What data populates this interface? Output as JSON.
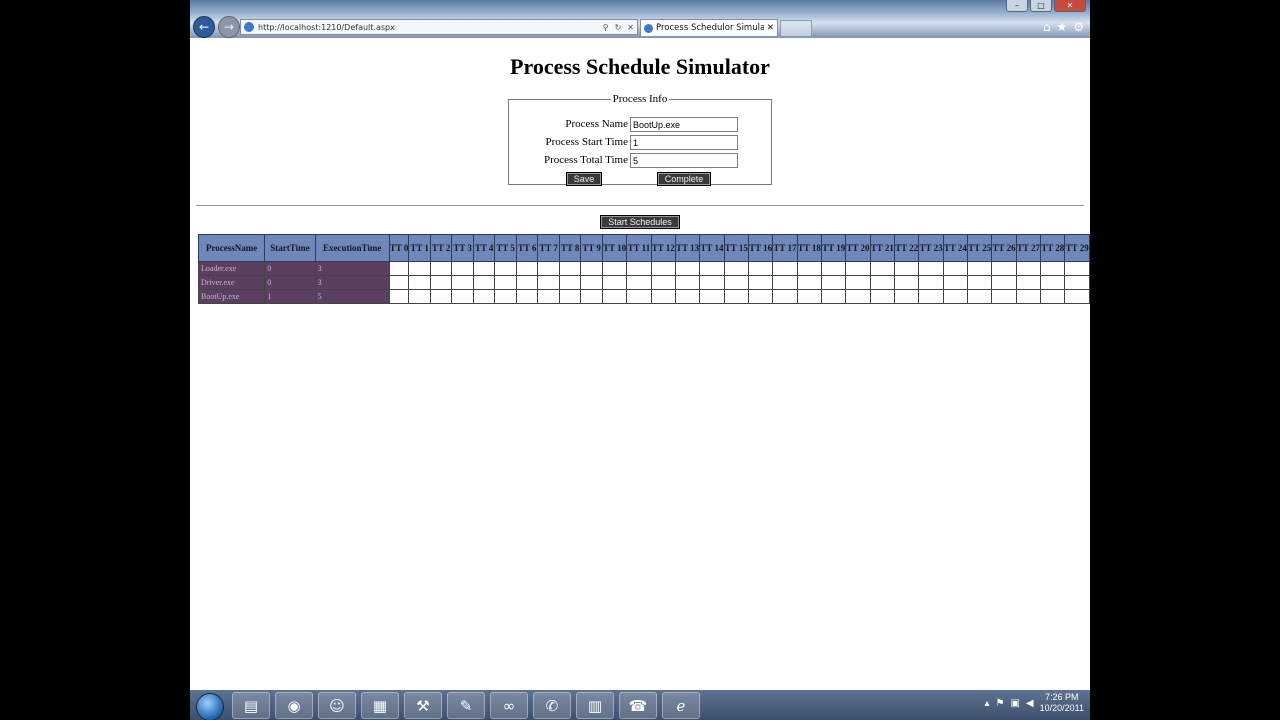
{
  "browser": {
    "address": "http://localhost:1210/Default.aspx",
    "tab_title": "Process Schedulor Simulator",
    "tab_close": "✕"
  },
  "page": {
    "title": "Process Schedule Simulator",
    "form": {
      "legend": "Process Info",
      "name_label": "Process Name",
      "name_value": "BootUp.exe",
      "start_label": "Process Start Time",
      "start_value": "1",
      "total_label": "Process Total Time",
      "total_value": "5",
      "save_label": "Save",
      "complete_label": "Complete"
    },
    "start_button": "Start Schedules",
    "table": {
      "headers": [
        "ProcessName",
        "StartTime",
        "ExecutionTime"
      ],
      "time_headers": [
        "TT 0",
        "TT 1",
        "TT 2",
        "TT 3",
        "TT 4",
        "TT 5",
        "TT 6",
        "TT 7",
        "TT 8",
        "TT 9",
        "TT 10",
        "TT 11",
        "TT 12",
        "TT 13",
        "TT 14",
        "TT 15",
        "TT 16",
        "TT 17",
        "TT 18",
        "TT 19",
        "TT 20",
        "TT 21",
        "TT 22",
        "TT 23",
        "TT 24",
        "TT 25",
        "TT 26",
        "TT 27",
        "TT 28",
        "TT 29"
      ],
      "rows": [
        {
          "name": "Loader.exe",
          "start": "0",
          "exec": "3"
        },
        {
          "name": "Driver.exe",
          "start": "0",
          "exec": "3"
        },
        {
          "name": "BootUp.exe",
          "start": "1",
          "exec": "5"
        }
      ]
    }
  },
  "taskbar": {
    "icons": [
      "explorer-icon",
      "chrome-icon",
      "contacts-icon",
      "backpack-icon",
      "tools-icon",
      "editor-icon",
      "link-icon",
      "talk-icon",
      "notebook-icon",
      "phone-icon",
      "ie-icon"
    ],
    "time": "7:26 PM",
    "date": "10/20/2011"
  }
}
